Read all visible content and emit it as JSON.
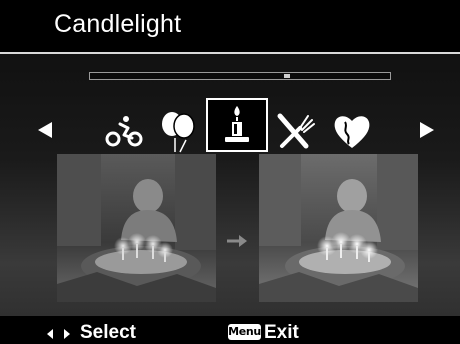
{
  "header": {
    "title": "Candlelight"
  },
  "scene_selector": {
    "scroll_position": 0.66,
    "modes": [
      {
        "name": "cycling",
        "icon": "bicycle-icon",
        "selected": false
      },
      {
        "name": "party",
        "icon": "balloons-icon",
        "selected": false
      },
      {
        "name": "candlelight",
        "icon": "candle-icon",
        "selected": true
      },
      {
        "name": "food",
        "icon": "fork-knife-icon",
        "selected": false
      },
      {
        "name": "love",
        "icon": "heart-icon",
        "selected": false
      }
    ],
    "prev_icon": "left-arrow-icon",
    "next_icon": "right-arrow-icon"
  },
  "preview": {
    "before": "preview-before-image",
    "after": "preview-after-image",
    "arrow_icon": "arrow-right-icon"
  },
  "footer": {
    "select_label": "Select",
    "menu_key": "Menu",
    "exit_label": "Exit"
  },
  "colors": {
    "background": "#000000",
    "text": "#ffffff",
    "divider": "#d8d8d8"
  }
}
